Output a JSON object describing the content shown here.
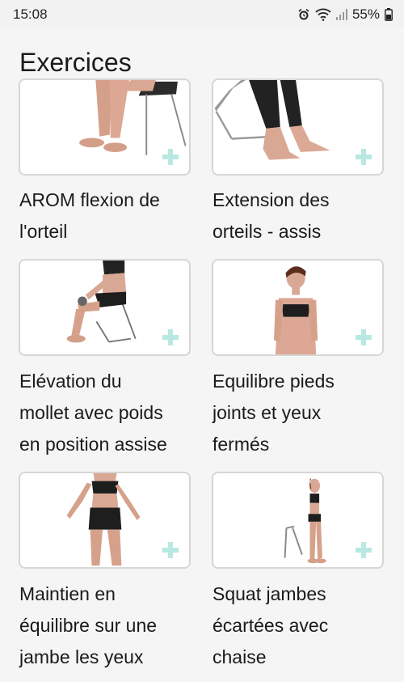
{
  "status": {
    "time": "15:08",
    "battery": "55%"
  },
  "page": {
    "title": "Exercices"
  },
  "exercises": [
    {
      "label_lines": [
        "AROM flexion de",
        "l'orteil"
      ],
      "image": "feet-under-chair"
    },
    {
      "label_lines": [
        "Extension des",
        "orteils - assis"
      ],
      "image": "bare-feet-chair"
    },
    {
      "label_lines": [
        "Elévation du",
        "mollet avec poids",
        "en position assise"
      ],
      "image": "seated-calf-raise"
    },
    {
      "label_lines": [
        "Equilibre pieds",
        "joints et yeux",
        "fermés"
      ],
      "image": "standing-woman"
    },
    {
      "label_lines": [
        "Maintien en",
        "équilibre sur une",
        "jambe les yeux"
      ],
      "image": "woman-front-standing"
    },
    {
      "label_lines": [
        "Squat jambes",
        "écartées avec",
        "chaise"
      ],
      "image": "woman-with-chair"
    }
  ],
  "colors": {
    "plus_icon": "#b8e8e2",
    "card_border": "#d6d6d6",
    "background": "#f5f5f5"
  },
  "icons": {
    "add": "plus-icon",
    "alarm": "alarm-icon",
    "wifi": "wifi-icon",
    "signal": "signal-icon",
    "battery": "battery-icon"
  }
}
